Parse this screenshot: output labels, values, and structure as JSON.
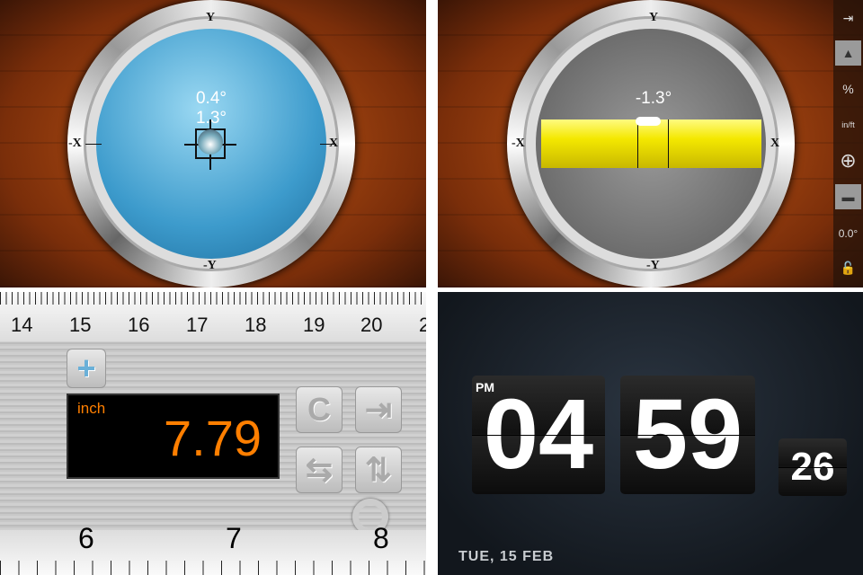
{
  "bubble_level": {
    "axis_top": "Y",
    "axis_bottom": "-Y",
    "axis_left": "-X",
    "axis_right": "X",
    "reading_x": "0.4°",
    "reading_y": "1.3°"
  },
  "tube_level": {
    "axis_top": "Y",
    "axis_bottom": "-Y",
    "axis_left": "-X",
    "axis_right": "X",
    "reading": "-1.3°",
    "toolbar": [
      {
        "icon": "exit-icon",
        "label": "⇥"
      },
      {
        "icon": "mountain-icon",
        "label": "▲"
      },
      {
        "icon": "percent-slope-icon",
        "label": "%"
      },
      {
        "icon": "inch-per-foot-icon",
        "label": "in/ft"
      },
      {
        "icon": "target-icon",
        "label": "⊕"
      },
      {
        "icon": "surface-icon",
        "label": "▬"
      },
      {
        "icon": "zero-degree-icon",
        "label": "0.0°"
      },
      {
        "icon": "lock-open-icon",
        "label": "🔓"
      }
    ]
  },
  "ruler": {
    "top_numbers": [
      "14",
      "15",
      "16",
      "17",
      "18",
      "19",
      "20",
      "2"
    ],
    "bottom_numbers": [
      "6",
      "7",
      "8"
    ],
    "unit": "inch",
    "value": "7.79",
    "buttons": {
      "add": "+",
      "clear": "C",
      "export": "⇥",
      "swap": "⇆",
      "flip": "⇅"
    },
    "accent": "#ff7f00"
  },
  "clock": {
    "ampm": "PM",
    "hours": "04",
    "minutes": "59",
    "seconds": "26",
    "date": "TUE, 15 FEB"
  }
}
